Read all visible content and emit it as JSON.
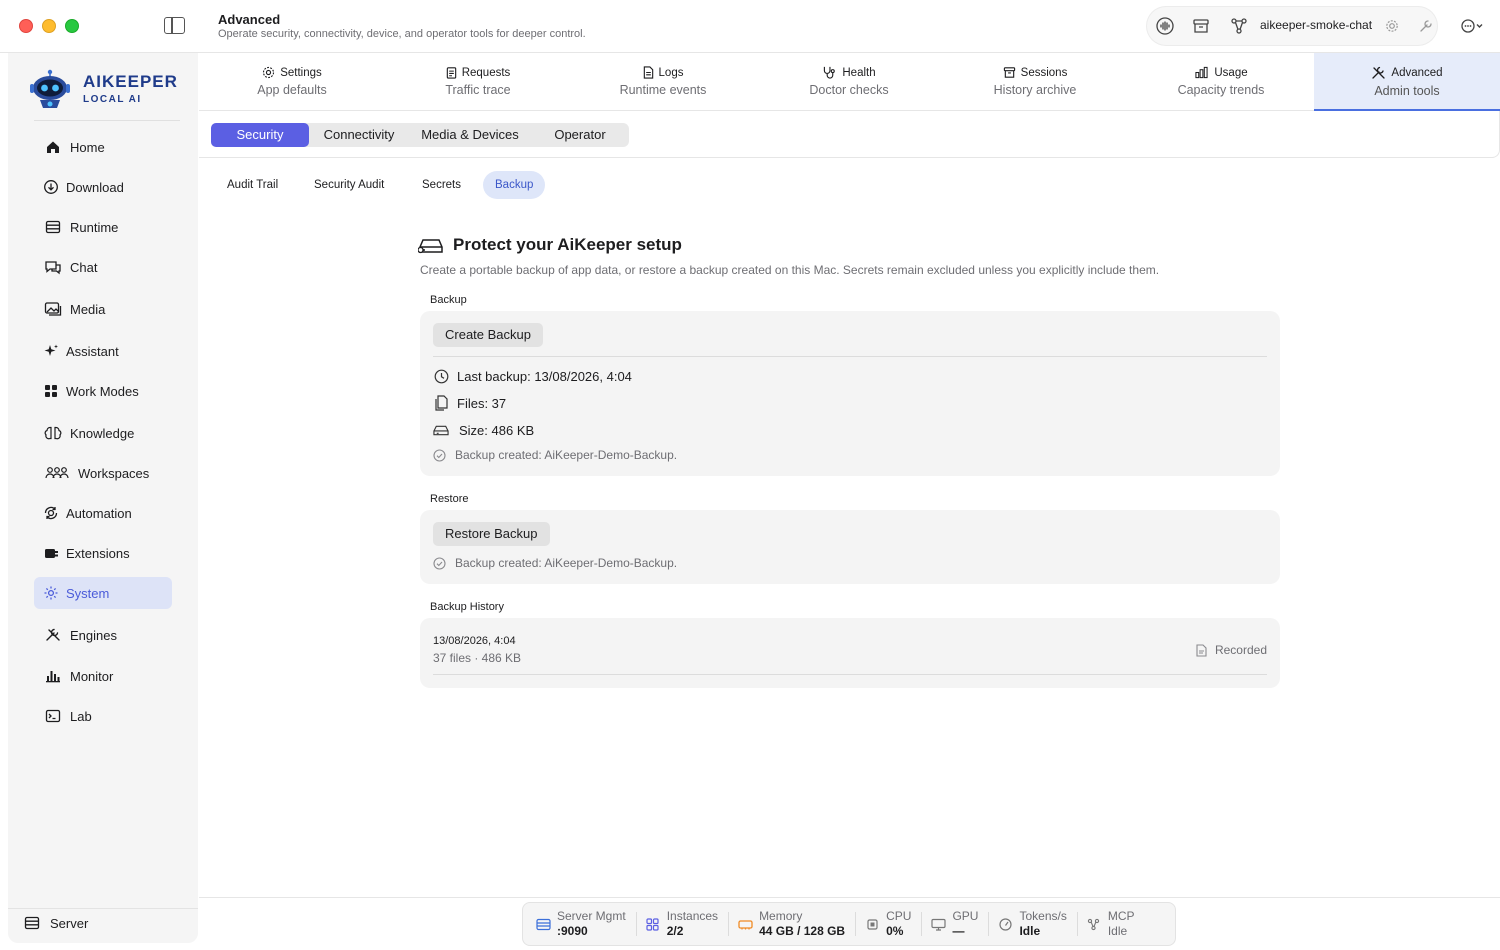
{
  "window": {
    "title": "Advanced",
    "subtitle": "Operate security, connectivity, device, and operator tools for deeper control."
  },
  "toolbar": {
    "chat_name": "aikeeper-smoke-chat"
  },
  "brand": {
    "name": "AIKEEPER",
    "tagline": "LOCAL AI",
    "accent": "#1f3b8a"
  },
  "sidebar": {
    "items": [
      {
        "label": "Home",
        "icon": "house-icon"
      },
      {
        "label": "Download",
        "icon": "download-icon"
      },
      {
        "label": "Runtime",
        "icon": "runtime-icon"
      },
      {
        "label": "Chat",
        "icon": "chat-icon"
      },
      {
        "label": "Media",
        "icon": "media-icon"
      },
      {
        "label": "Assistant",
        "icon": "sparkle-icon"
      },
      {
        "label": "Work Modes",
        "icon": "grid-icon"
      },
      {
        "label": "Knowledge",
        "icon": "brain-icon"
      },
      {
        "label": "Workspaces",
        "icon": "people-icon"
      },
      {
        "label": "Automation",
        "icon": "automation-icon"
      },
      {
        "label": "Extensions",
        "icon": "plug-icon"
      },
      {
        "label": "System",
        "icon": "gear-icon",
        "active": true
      },
      {
        "label": "Engines",
        "icon": "tools-icon"
      },
      {
        "label": "Monitor",
        "icon": "bar-chart-icon"
      },
      {
        "label": "Lab",
        "icon": "terminal-icon"
      }
    ],
    "footer": {
      "label": "Server"
    }
  },
  "top_tabs": [
    {
      "title": "Settings",
      "subtitle": "App defaults"
    },
    {
      "title": "Requests",
      "subtitle": "Traffic trace"
    },
    {
      "title": "Logs",
      "subtitle": "Runtime events"
    },
    {
      "title": "Health",
      "subtitle": "Doctor checks"
    },
    {
      "title": "Sessions",
      "subtitle": "History archive"
    },
    {
      "title": "Usage",
      "subtitle": "Capacity trends"
    },
    {
      "title": "Advanced",
      "subtitle": "Admin tools",
      "active": true
    }
  ],
  "segments": [
    "Security",
    "Connectivity",
    "Media & Devices",
    "Operator"
  ],
  "sub_tabs": [
    "Audit Trail",
    "Security Audit",
    "Secrets",
    "Backup"
  ],
  "content": {
    "title": "Protect your AiKeeper setup",
    "description": "Create a portable backup of app data, or restore a backup created on this Mac. Secrets remain excluded unless you explicitly include them.",
    "backup": {
      "label": "Backup",
      "button": "Create Backup",
      "last_backup": "Last backup: 13/08/2026, 4:04",
      "files": "Files: 37",
      "size": "Size: 486 KB",
      "status": "Backup created: AiKeeper-Demo-Backup."
    },
    "restore": {
      "label": "Restore",
      "button": "Restore Backup",
      "status": "Backup created: AiKeeper-Demo-Backup."
    },
    "history": {
      "label": "Backup History",
      "entries": [
        {
          "date": "13/08/2026, 4:04",
          "meta": "37 files · 486 KB",
          "state": "Recorded"
        }
      ]
    }
  },
  "status_bar": [
    {
      "label": "Server Mgmt",
      "value": ":9090",
      "icon": "server-icon",
      "color": "#3b6fd9"
    },
    {
      "label": "Instances",
      "value": "2/2",
      "icon": "instances-icon",
      "color": "#5b5fe3"
    },
    {
      "label": "Memory",
      "value": "44 GB / 128 GB",
      "icon": "memory-icon",
      "color": "#f08a24"
    },
    {
      "label": "CPU",
      "value": "0%",
      "icon": "cpu-icon",
      "color": "#777777"
    },
    {
      "label": "GPU",
      "value": "—",
      "icon": "gpu-icon",
      "color": "#777777"
    },
    {
      "label": "Tokens/s",
      "value": "Idle",
      "icon": "gauge-icon",
      "color": "#777777"
    },
    {
      "label": "MCP",
      "value": "Idle",
      "icon": "mcp-icon",
      "color": "#777777",
      "muted": true
    }
  ],
  "colors": {
    "accent": "#5b5fe3",
    "active_tab_bg": "#e6ecfa",
    "active_sidebar_bg": "#dde3f7"
  }
}
